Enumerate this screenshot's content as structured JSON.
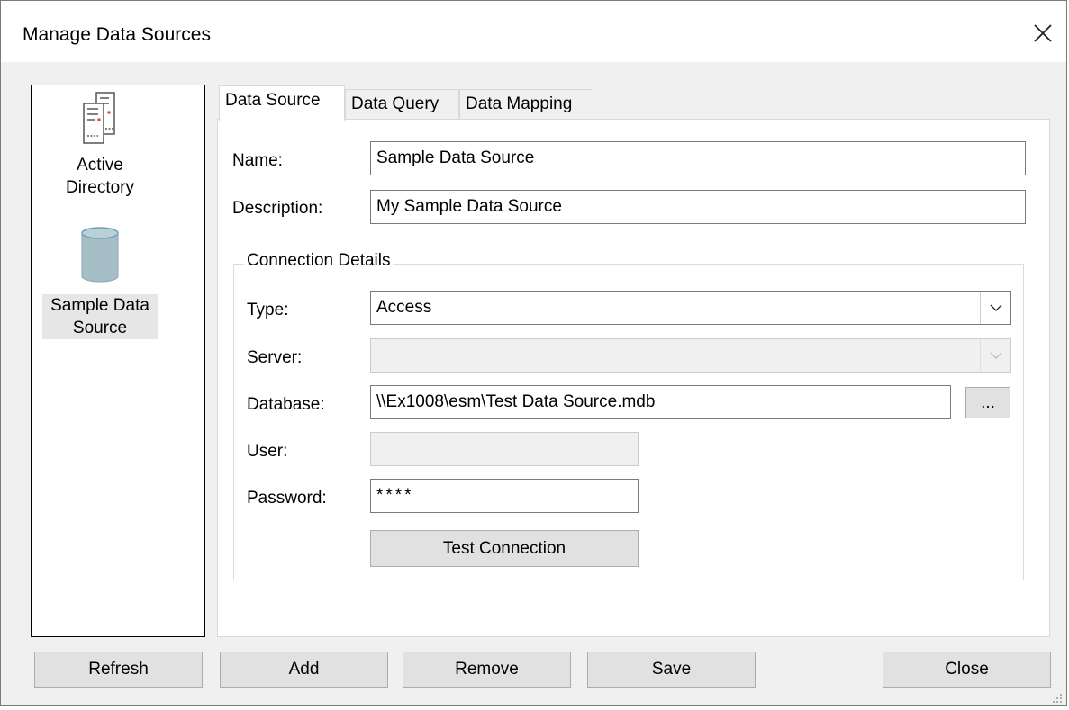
{
  "window": {
    "title": "Manage Data Sources"
  },
  "sources": [
    {
      "icon": "server-icon",
      "label_line1": "Active",
      "label_line2": "Directory"
    },
    {
      "icon": "database-icon",
      "label_line1": "Sample Data",
      "label_line2": "Source",
      "selected": true
    }
  ],
  "tabs": [
    {
      "label": "Data Source",
      "active": true
    },
    {
      "label": "Data Query"
    },
    {
      "label": "Data Mapping"
    }
  ],
  "form": {
    "name_label": "Name:",
    "name_value": "Sample Data Source",
    "description_label": "Description:",
    "description_value": "My Sample Data Source"
  },
  "connection": {
    "group_title": "Connection Details",
    "type_label": "Type:",
    "type_value": "Access",
    "server_label": "Server:",
    "server_value": "",
    "database_label": "Database:",
    "database_value": "\\\\Ex1008\\esm\\Test Data Source.mdb",
    "browse_label": "...",
    "user_label": "User:",
    "user_value": "",
    "password_label": "Password:",
    "password_value": "****",
    "test_button": "Test Connection"
  },
  "buttons": {
    "refresh": "Refresh",
    "add": "Add",
    "remove": "Remove",
    "save": "Save",
    "close": "Close"
  }
}
